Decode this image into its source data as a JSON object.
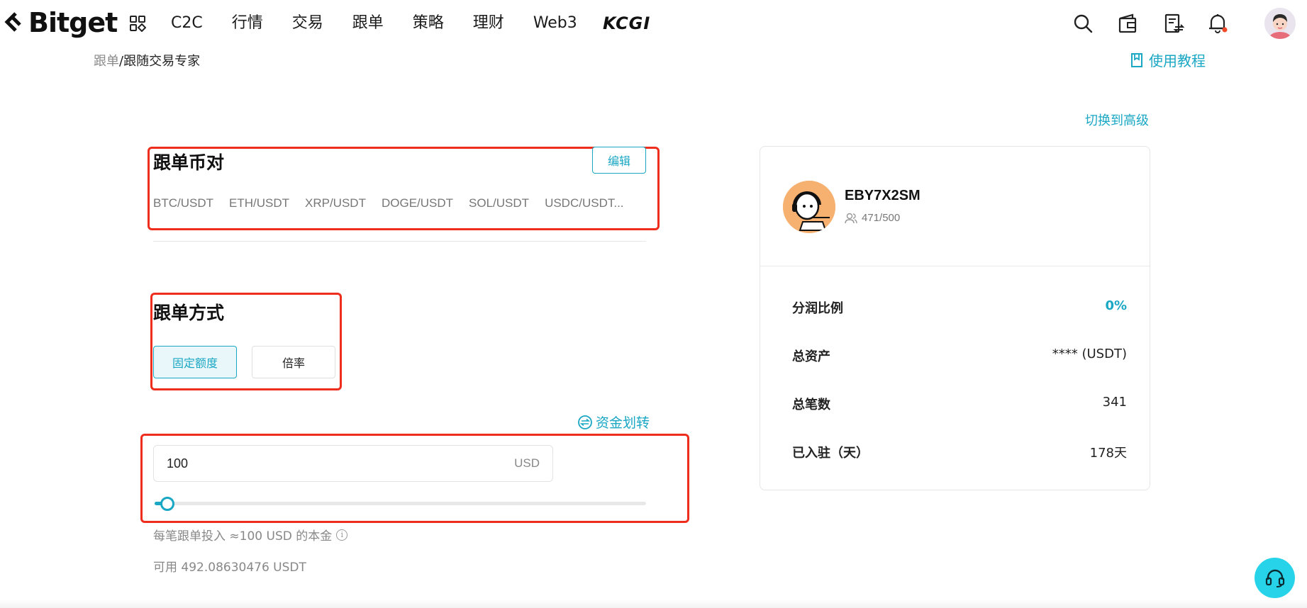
{
  "header": {
    "brand": "Bitget",
    "nav": [
      "C2C",
      "行情",
      "交易",
      "跟单",
      "策略",
      "理财",
      "Web3"
    ],
    "partner_logo": "KCGI",
    "icons": [
      "search-icon",
      "wallet-icon",
      "orders-icon",
      "bell-icon"
    ]
  },
  "breadcrumb": {
    "parent": "跟单",
    "separator": "/",
    "current": "跟随交易专家"
  },
  "tutorial_link": "使用教程",
  "switch_advanced": "切换到高级",
  "pairs_section": {
    "title": "跟单币对",
    "edit_label": "编辑",
    "pairs": [
      "BTC/USDT",
      "ETH/USDT",
      "XRP/USDT",
      "DOGE/USDT",
      "SOL/USDT",
      "USDC/USDT..."
    ]
  },
  "mode_section": {
    "title": "跟单方式",
    "options": [
      "固定额度",
      "倍率"
    ],
    "selected": "固定额度"
  },
  "transfer_label": "资金划转",
  "amount": {
    "value": "100",
    "unit": "USD",
    "slider_percent": 2
  },
  "hint": "每笔跟单投入 ≈100 USD 的本金",
  "available": "可用 492.08630476 USDT",
  "trader": {
    "name": "EBY7X2SM",
    "followers": "471/500",
    "stats": [
      {
        "label": "分润比例",
        "value": "0%"
      },
      {
        "label": "总资产",
        "value": "**** (USDT)"
      },
      {
        "label": "总笔数",
        "value": "341"
      },
      {
        "label": "已入驻（天）",
        "value": "178天"
      }
    ]
  },
  "colors": {
    "accent": "#1aa7c4",
    "annotation": "#ee2d1d",
    "support_button": "#27d3e8"
  }
}
